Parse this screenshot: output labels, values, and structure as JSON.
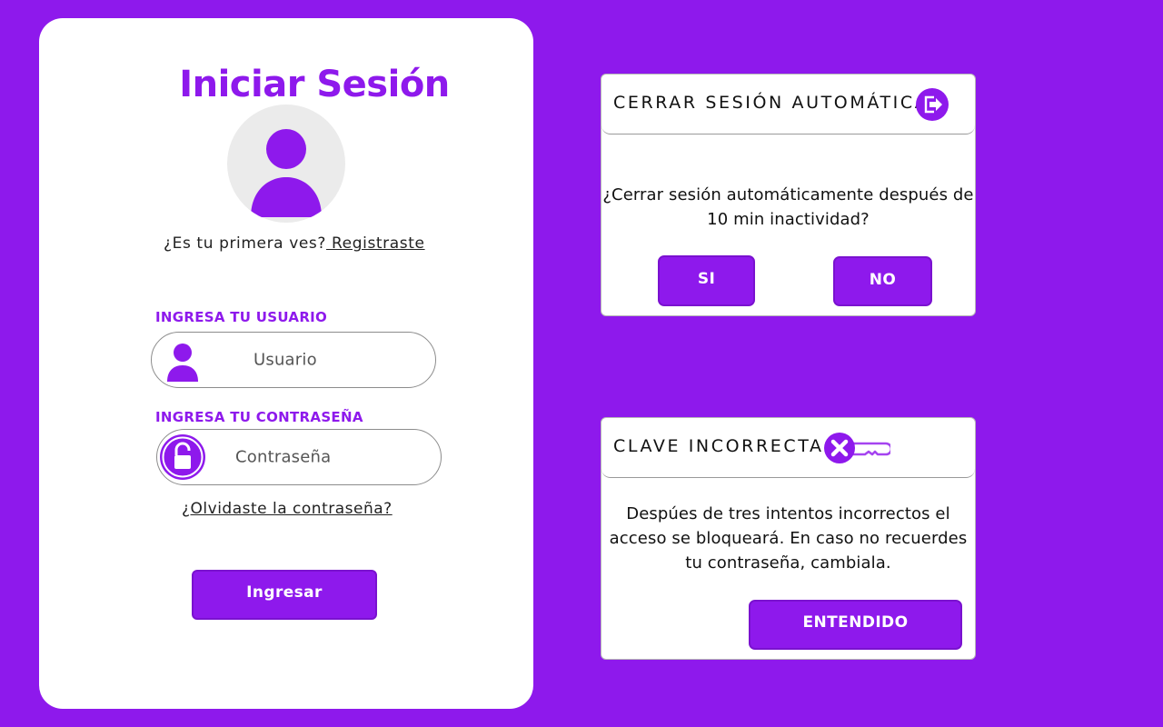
{
  "login": {
    "title": "Iniciar Sesión",
    "first_time_text": "¿Es tu primera ves?",
    "register_link": " Registraste ",
    "username_label": "INGRESA TU USUARIO",
    "username_placeholder": "Usuario",
    "password_label": "INGRESA TU CONTRASEÑA",
    "password_placeholder": "Contraseña",
    "forgot_link": "¿Olvidaste la contraseña?",
    "submit_label": "Ingresar"
  },
  "logout_dialog": {
    "title": "CERRAR SESIÓN AUTOMÁTICA",
    "icon": "logout-icon",
    "message": "¿Cerrar sesión automáticamente después de 10 min inactividad?",
    "yes_label": "SI",
    "no_label": "NO"
  },
  "wrong_password_dialog": {
    "title": "CLAVE INCORRECTA",
    "icon": "wrong-key-icon",
    "message": "Despúes de tres intentos incorrectos el acceso se bloqueará. En caso no recuerdes tu contraseña, cambiala.",
    "ok_label": "ENTENDIDO"
  },
  "colors": {
    "accent": "#8e19ec",
    "card_background": "#ffffff",
    "avatar_background": "#ebebeb"
  }
}
